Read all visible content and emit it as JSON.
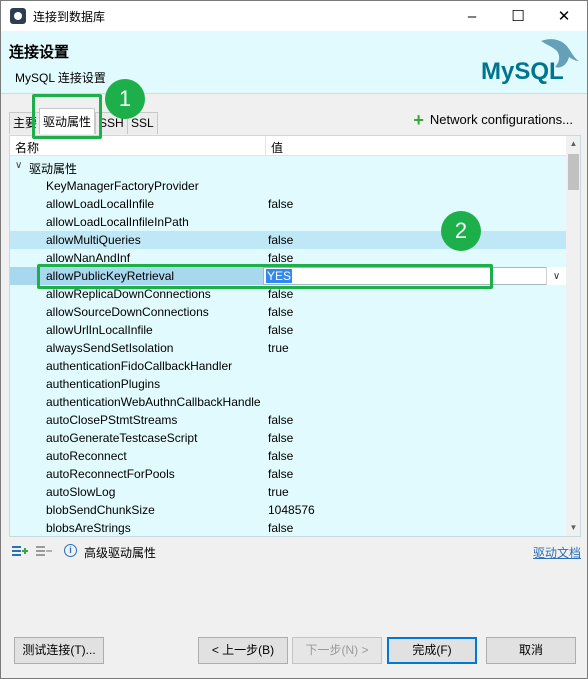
{
  "window": {
    "title": "连接到数据库",
    "controls": [
      "minimize",
      "maximize",
      "close"
    ]
  },
  "header": {
    "title": "连接设置",
    "subtitle": "MySQL 连接设置",
    "logo_text": "MySQL"
  },
  "tabs": [
    {
      "label": "主要",
      "active": false
    },
    {
      "label": "驱动属性",
      "active": true
    },
    {
      "label": "SSH",
      "active": false
    },
    {
      "label": "SSL",
      "active": false
    }
  ],
  "network_button": "Network configurations...",
  "table": {
    "col_name": "名称",
    "col_value": "值",
    "group_label": "驱动属性",
    "rows": [
      {
        "name": "KeyManagerFactoryProvider",
        "value": ""
      },
      {
        "name": "allowLoadLocalInfile",
        "value": "false"
      },
      {
        "name": "allowLoadLocalInfileInPath",
        "value": ""
      },
      {
        "name": "allowMultiQueries",
        "value": "false"
      },
      {
        "name": "allowNanAndInf",
        "value": "false"
      },
      {
        "name": "allowPublicKeyRetrieval",
        "value": "YES"
      },
      {
        "name": "allowReplicaDownConnections",
        "value": "false"
      },
      {
        "name": "allowSourceDownConnections",
        "value": "false"
      },
      {
        "name": "allowUrlInLocalInfile",
        "value": "false"
      },
      {
        "name": "alwaysSendSetIsolation",
        "value": "true"
      },
      {
        "name": "authenticationFidoCallbackHandler",
        "value": ""
      },
      {
        "name": "authenticationPlugins",
        "value": ""
      },
      {
        "name": "authenticationWebAuthnCallbackHandle",
        "value": ""
      },
      {
        "name": "autoClosePStmtStreams",
        "value": "false"
      },
      {
        "name": "autoGenerateTestcaseScript",
        "value": "false"
      },
      {
        "name": "autoReconnect",
        "value": "false"
      },
      {
        "name": "autoReconnectForPools",
        "value": "false"
      },
      {
        "name": "autoSlowLog",
        "value": "true"
      },
      {
        "name": "blobSendChunkSize",
        "value": "1048576"
      },
      {
        "name": "blobsAreStrings",
        "value": "false"
      }
    ]
  },
  "bottom_toolbar": {
    "advanced_label": "高级驱动属性",
    "doc_link": "驱动文档"
  },
  "buttons": {
    "test": "测试连接(T)...",
    "back": "< 上一步(B)",
    "next": "下一步(N) >",
    "finish": "完成(F)",
    "cancel": "取消"
  },
  "annotations": [
    "1",
    "2"
  ],
  "colors": {
    "accent_green": "#1db04a",
    "header_bg": "#e1fafd",
    "link": "#2b6fb6"
  }
}
